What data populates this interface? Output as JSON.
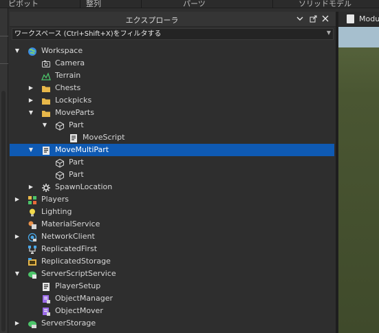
{
  "ribbon": {
    "items": [
      "ピボット",
      "整列",
      "パーツ",
      "ソリッドモデル"
    ]
  },
  "explorer": {
    "title": "エクスプローラ",
    "filter_placeholder": "ワークスペース (Ctrl+Shift+X)をフィルタする"
  },
  "tree": [
    {
      "label": "Workspace",
      "icon": "workspace-globe-icon",
      "arrow": "expanded"
    },
    {
      "label": "Camera",
      "icon": "camera-icon",
      "arrow": "none"
    },
    {
      "label": "Terrain",
      "icon": "terrain-icon",
      "arrow": "none"
    },
    {
      "label": "Chests",
      "icon": "folder-icon",
      "arrow": "collapsed"
    },
    {
      "label": "Lockpicks",
      "icon": "folder-icon",
      "arrow": "collapsed"
    },
    {
      "label": "MoveParts",
      "icon": "folder-icon",
      "arrow": "expanded"
    },
    {
      "label": "Part",
      "icon": "part-cube-icon",
      "arrow": "expanded"
    },
    {
      "label": "MoveScript",
      "icon": "script-icon",
      "arrow": "none"
    },
    {
      "label": "MoveMultiPart",
      "icon": "script-icon",
      "arrow": "expanded",
      "selected": true
    },
    {
      "label": "Part",
      "icon": "part-cube-icon",
      "arrow": "none"
    },
    {
      "label": "Part",
      "icon": "part-cube-icon",
      "arrow": "none"
    },
    {
      "label": "SpawnLocation",
      "icon": "spawn-gear-icon",
      "arrow": "collapsed"
    },
    {
      "label": "Players",
      "icon": "players-icon",
      "arrow": "collapsed"
    },
    {
      "label": "Lighting",
      "icon": "lightbulb-icon",
      "arrow": "none"
    },
    {
      "label": "MaterialService",
      "icon": "material-service-icon",
      "arrow": "none"
    },
    {
      "label": "NetworkClient",
      "icon": "network-client-icon",
      "arrow": "collapsed"
    },
    {
      "label": "ReplicatedFirst",
      "icon": "replicated-first-icon",
      "arrow": "none"
    },
    {
      "label": "ReplicatedStorage",
      "icon": "replicated-storage-icon",
      "arrow": "none"
    },
    {
      "label": "ServerScriptService",
      "icon": "server-script-service-icon",
      "arrow": "expanded"
    },
    {
      "label": "PlayerSetup",
      "icon": "script-icon",
      "arrow": "none"
    },
    {
      "label": "ObjectManager",
      "icon": "module-script-icon",
      "arrow": "none"
    },
    {
      "label": "ObjectMover",
      "icon": "module-script-icon",
      "arrow": "none"
    },
    {
      "label": "ServerStorage",
      "icon": "server-storage-icon",
      "arrow": "collapsed"
    }
  ],
  "viewport": {
    "tab_label": "Modu"
  },
  "colors": {
    "selection": "#0f5ab3",
    "folder": "#e8b84a",
    "panel_bg": "#2e2e2e"
  }
}
